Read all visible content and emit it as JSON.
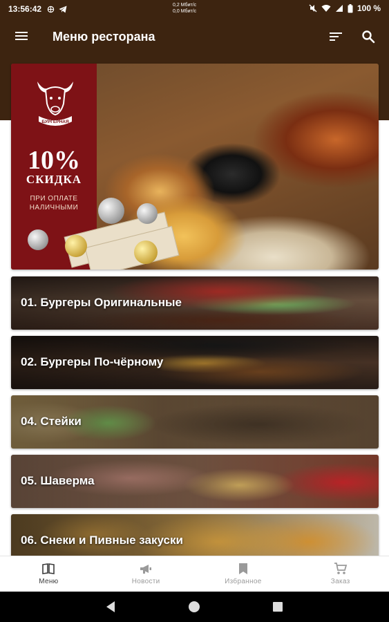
{
  "status_bar": {
    "time": "13:56:42",
    "speed_up": "0,2 Мбит/с",
    "speed_down": "0,0 Мбит/с",
    "battery": "100 %"
  },
  "app_bar": {
    "title": "Меню ресторана"
  },
  "banner": {
    "percent": "10%",
    "discount": "СКИДКА",
    "condition_line1": "ПРИ ОПЛАТЕ",
    "condition_line2": "НАЛИЧНЫМИ",
    "logo_text": "БУРГЕРНАЯ"
  },
  "categories": [
    {
      "label": "01. Бургеры Оригинальные"
    },
    {
      "label": "02. Бургеры По-чёрному"
    },
    {
      "label": "04. Стейки"
    },
    {
      "label": "05. Шаверма"
    },
    {
      "label": "06. Снеки и Пивные закуски"
    }
  ],
  "bottom_nav": [
    {
      "label": "Меню",
      "icon": "book-icon",
      "active": true
    },
    {
      "label": "Новости",
      "icon": "megaphone-icon",
      "active": false
    },
    {
      "label": "Избранное",
      "icon": "bookmark-icon",
      "active": false
    },
    {
      "label": "Заказ",
      "icon": "cart-icon",
      "active": false
    }
  ],
  "colors": {
    "app_bar": "#3d2410",
    "banner_panel": "#7e1216",
    "active_nav": "#3a3a3a",
    "inactive_nav": "#9a9a9a"
  }
}
